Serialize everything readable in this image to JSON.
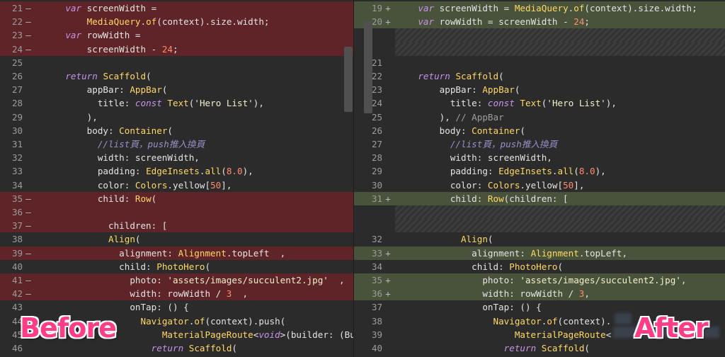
{
  "left_pane": {
    "lines": [
      {
        "type": "del",
        "num": "21",
        "marker": "—",
        "tokens": [
          [
            "",
            "    "
          ],
          [
            "kw",
            "var"
          ],
          [
            "id",
            " screenWidth ="
          ]
        ]
      },
      {
        "type": "del",
        "num": "22",
        "marker": "—",
        "tokens": [
          [
            "",
            "        "
          ],
          [
            "fn",
            "MediaQuery"
          ],
          [
            "op",
            "."
          ],
          [
            "fn",
            "of"
          ],
          [
            "id",
            "(context).size.width;"
          ]
        ]
      },
      {
        "type": "del",
        "num": "23",
        "marker": "—",
        "tokens": [
          [
            "",
            "    "
          ],
          [
            "kw",
            "var"
          ],
          [
            "id",
            " rowWidth ="
          ]
        ]
      },
      {
        "type": "del",
        "num": "24",
        "marker": "—",
        "tokens": [
          [
            "",
            "        screenWidth - "
          ],
          [
            "num",
            "24"
          ],
          [
            "id",
            ";"
          ]
        ]
      },
      {
        "type": "ctx",
        "num": "25",
        "marker": "",
        "tokens": []
      },
      {
        "type": "ctx",
        "num": "26",
        "marker": "",
        "tokens": [
          [
            "",
            "    "
          ],
          [
            "kw",
            "return"
          ],
          [
            "id",
            " "
          ],
          [
            "fn",
            "Scaffold"
          ],
          [
            "id",
            "("
          ]
        ]
      },
      {
        "type": "ctx",
        "num": "27",
        "marker": "",
        "tokens": [
          [
            "",
            "        appBar: "
          ],
          [
            "fn",
            "AppBar"
          ],
          [
            "id",
            "("
          ]
        ]
      },
      {
        "type": "ctx",
        "num": "28",
        "marker": "",
        "tokens": [
          [
            "",
            "          title: "
          ],
          [
            "kw2",
            "const"
          ],
          [
            "id",
            " "
          ],
          [
            "fn",
            "Text"
          ],
          [
            "id",
            "("
          ],
          [
            "str",
            "'Hero List'"
          ],
          [
            "id",
            "),"
          ]
        ]
      },
      {
        "type": "ctx",
        "num": "29",
        "marker": "",
        "tokens": [
          [
            "",
            "        ),"
          ]
        ]
      },
      {
        "type": "ctx",
        "num": "30",
        "marker": "",
        "tokens": [
          [
            "",
            "        body: "
          ],
          [
            "fn",
            "Container"
          ],
          [
            "id",
            "("
          ]
        ]
      },
      {
        "type": "ctx",
        "num": "31",
        "marker": "",
        "tokens": [
          [
            "",
            "          "
          ],
          [
            "com",
            "//list頁，push推入換頁"
          ]
        ]
      },
      {
        "type": "ctx",
        "num": "32",
        "marker": "",
        "tokens": [
          [
            "",
            "          width: screenWidth,"
          ]
        ]
      },
      {
        "type": "ctx",
        "num": "33",
        "marker": "",
        "tokens": [
          [
            "",
            "          padding: "
          ],
          [
            "fn",
            "EdgeInsets"
          ],
          [
            "id",
            "."
          ],
          [
            "fn",
            "all"
          ],
          [
            "id",
            "("
          ],
          [
            "num",
            "8.0"
          ],
          [
            "id",
            "),"
          ]
        ]
      },
      {
        "type": "ctx",
        "num": "34",
        "marker": "",
        "tokens": [
          [
            "",
            "          color: "
          ],
          [
            "fn",
            "Colors"
          ],
          [
            "id",
            ".yellow["
          ],
          [
            "num",
            "50"
          ],
          [
            "id",
            "],"
          ]
        ]
      },
      {
        "type": "del",
        "num": "35",
        "marker": "—",
        "tokens": [
          [
            "",
            "          child: "
          ],
          [
            "fn",
            "Row"
          ],
          [
            "id",
            "("
          ]
        ]
      },
      {
        "type": "del",
        "num": "36",
        "marker": "—",
        "tokens": []
      },
      {
        "type": "del",
        "num": "37",
        "marker": "—",
        "tokens": [
          [
            "",
            "            children: ["
          ]
        ]
      },
      {
        "type": "ctx",
        "num": "38",
        "marker": "",
        "tokens": [
          [
            "",
            "            "
          ],
          [
            "fn",
            "Align"
          ],
          [
            "id",
            "("
          ]
        ]
      },
      {
        "type": "del",
        "num": "39",
        "marker": "—",
        "tokens": [
          [
            "",
            "              alignment: "
          ],
          [
            "fn",
            "Alignment"
          ],
          [
            "id",
            ".topLeft  ,"
          ]
        ]
      },
      {
        "type": "ctx",
        "num": "40",
        "marker": "",
        "tokens": [
          [
            "",
            "              child: "
          ],
          [
            "fn",
            "PhotoHero"
          ],
          [
            "id",
            "("
          ]
        ]
      },
      {
        "type": "del",
        "num": "41",
        "marker": "—",
        "tokens": [
          [
            "",
            "                photo: "
          ],
          [
            "str",
            "'assets/images/succulent2.jpg'"
          ],
          [
            "id",
            "  ,"
          ]
        ]
      },
      {
        "type": "del",
        "num": "42",
        "marker": "—",
        "tokens": [
          [
            "",
            "                width: rowWidth / "
          ],
          [
            "num",
            "3"
          ],
          [
            "id",
            "  ,"
          ]
        ]
      },
      {
        "type": "ctx",
        "num": "43",
        "marker": "",
        "tokens": [
          [
            "",
            "                onTap: () {"
          ]
        ]
      },
      {
        "type": "ctx",
        "num": "44",
        "marker": "",
        "tokens": [
          [
            "",
            "                  "
          ],
          [
            "fn",
            "Navigator"
          ],
          [
            "id",
            "."
          ],
          [
            "fn",
            "of"
          ],
          [
            "id",
            "(context).push("
          ]
        ]
      },
      {
        "type": "ctx",
        "num": "45",
        "marker": "",
        "tokens": [
          [
            "",
            "                      "
          ],
          [
            "fn",
            "MaterialPageRoute"
          ],
          [
            "id",
            "<"
          ],
          [
            "kw",
            "void"
          ],
          [
            "id",
            ">(builder: (Bui"
          ]
        ]
      },
      {
        "type": "ctx",
        "num": "46",
        "marker": "",
        "tokens": [
          [
            "",
            "                    "
          ],
          [
            "kw",
            "return"
          ],
          [
            "id",
            " "
          ],
          [
            "fn",
            "Scaffold"
          ],
          [
            "id",
            "("
          ]
        ]
      }
    ]
  },
  "right_pane": {
    "lines": [
      {
        "type": "add",
        "num": "19",
        "marker": "+",
        "tokens": [
          [
            "",
            "    "
          ],
          [
            "kw",
            "var"
          ],
          [
            "id",
            " screenWidth = "
          ],
          [
            "fn",
            "MediaQuery"
          ],
          [
            "id",
            "."
          ],
          [
            "fn",
            "of"
          ],
          [
            "id",
            "(context).size.width;"
          ]
        ]
      },
      {
        "type": "add",
        "num": "20",
        "marker": "+",
        "tokens": [
          [
            "",
            "    "
          ],
          [
            "kw",
            "var"
          ],
          [
            "id",
            " rowWidth = screenWidth - "
          ],
          [
            "num",
            "24"
          ],
          [
            "id",
            ";"
          ]
        ]
      },
      {
        "type": "gap",
        "num": "",
        "marker": "",
        "tokens": []
      },
      {
        "type": "gap",
        "num": "",
        "marker": "",
        "tokens": []
      },
      {
        "type": "ctx",
        "num": "21",
        "marker": "",
        "tokens": []
      },
      {
        "type": "ctx",
        "num": "22",
        "marker": "",
        "tokens": [
          [
            "",
            "    "
          ],
          [
            "kw",
            "return"
          ],
          [
            "id",
            " "
          ],
          [
            "fn",
            "Scaffold"
          ],
          [
            "id",
            "("
          ]
        ]
      },
      {
        "type": "ctx",
        "num": "23",
        "marker": "",
        "tokens": [
          [
            "",
            "        appBar: "
          ],
          [
            "fn",
            "AppBar"
          ],
          [
            "id",
            "("
          ]
        ]
      },
      {
        "type": "ctx",
        "num": "24",
        "marker": "",
        "tokens": [
          [
            "",
            "          title: "
          ],
          [
            "kw2",
            "const"
          ],
          [
            "id",
            " "
          ],
          [
            "fn",
            "Text"
          ],
          [
            "id",
            "("
          ],
          [
            "str",
            "'Hero List'"
          ],
          [
            "id",
            "),"
          ]
        ]
      },
      {
        "type": "ctx",
        "num": "25",
        "marker": "",
        "tokens": [
          [
            "",
            "        ), "
          ],
          [
            "grey",
            "// AppBar"
          ]
        ]
      },
      {
        "type": "ctx",
        "num": "26",
        "marker": "",
        "tokens": [
          [
            "",
            "        body: "
          ],
          [
            "fn",
            "Container"
          ],
          [
            "id",
            "("
          ]
        ]
      },
      {
        "type": "ctx",
        "num": "27",
        "marker": "",
        "tokens": [
          [
            "",
            "          "
          ],
          [
            "com",
            "//list頁，push推入換頁"
          ]
        ]
      },
      {
        "type": "ctx",
        "num": "28",
        "marker": "",
        "tokens": [
          [
            "",
            "          width: screenWidth,"
          ]
        ]
      },
      {
        "type": "ctx",
        "num": "29",
        "marker": "",
        "tokens": [
          [
            "",
            "          padding: "
          ],
          [
            "fn",
            "EdgeInsets"
          ],
          [
            "id",
            "."
          ],
          [
            "fn",
            "all"
          ],
          [
            "id",
            "("
          ],
          [
            "num",
            "8.0"
          ],
          [
            "id",
            "),"
          ]
        ]
      },
      {
        "type": "ctx",
        "num": "30",
        "marker": "",
        "tokens": [
          [
            "",
            "          color: "
          ],
          [
            "fn",
            "Colors"
          ],
          [
            "id",
            ".yellow["
          ],
          [
            "num",
            "50"
          ],
          [
            "id",
            "],"
          ]
        ]
      },
      {
        "type": "add",
        "num": "31",
        "marker": "+",
        "tokens": [
          [
            "",
            "          child: "
          ],
          [
            "fn",
            "Row"
          ],
          [
            "id",
            "(children: ["
          ]
        ]
      },
      {
        "type": "gap",
        "num": "",
        "marker": "",
        "tokens": []
      },
      {
        "type": "gap",
        "num": "",
        "marker": "",
        "tokens": []
      },
      {
        "type": "ctx",
        "num": "32",
        "marker": "",
        "tokens": [
          [
            "",
            "            "
          ],
          [
            "fn",
            "Align"
          ],
          [
            "id",
            "("
          ]
        ]
      },
      {
        "type": "add",
        "num": "33",
        "marker": "+",
        "tokens": [
          [
            "",
            "              alignment: "
          ],
          [
            "fn",
            "Alignment"
          ],
          [
            "id",
            ".topLeft,"
          ]
        ]
      },
      {
        "type": "ctx",
        "num": "34",
        "marker": "",
        "tokens": [
          [
            "",
            "              child: "
          ],
          [
            "fn",
            "PhotoHero"
          ],
          [
            "id",
            "("
          ]
        ]
      },
      {
        "type": "add",
        "num": "35",
        "marker": "+",
        "tokens": [
          [
            "",
            "                photo: "
          ],
          [
            "str",
            "'assets/images/succulent2.jpg'"
          ],
          [
            "id",
            ","
          ]
        ]
      },
      {
        "type": "add",
        "num": "36",
        "marker": "+",
        "tokens": [
          [
            "",
            "                width: rowWidth / "
          ],
          [
            "num",
            "3"
          ],
          [
            "id",
            ","
          ]
        ]
      },
      {
        "type": "ctx",
        "num": "37",
        "marker": "",
        "tokens": [
          [
            "",
            "                onTap: () {"
          ]
        ]
      },
      {
        "type": "ctx",
        "num": "38",
        "marker": "",
        "tokens": [
          [
            "",
            "                  "
          ],
          [
            "fn",
            "Navigator"
          ],
          [
            "id",
            "."
          ],
          [
            "fn",
            "of"
          ],
          [
            "id",
            "(context)."
          ]
        ]
      },
      {
        "type": "ctx",
        "num": "39",
        "marker": "",
        "tokens": [
          [
            "",
            "                      "
          ],
          [
            "fn",
            "MaterialPageRoute"
          ],
          [
            "id",
            "<"
          ]
        ]
      },
      {
        "type": "ctx",
        "num": "40",
        "marker": "",
        "tokens": [
          [
            "",
            "                    "
          ],
          [
            "kw",
            "return"
          ],
          [
            "id",
            " "
          ],
          [
            "fn",
            "Scaffold"
          ],
          [
            "id",
            "("
          ]
        ]
      }
    ]
  },
  "labels": {
    "before": "Before",
    "after": "After"
  },
  "colors": {
    "deleted_bg": "#5e2427",
    "added_bg": "#49523a",
    "editor_bg": "#2b2b2b",
    "label": "#ff3d87"
  }
}
